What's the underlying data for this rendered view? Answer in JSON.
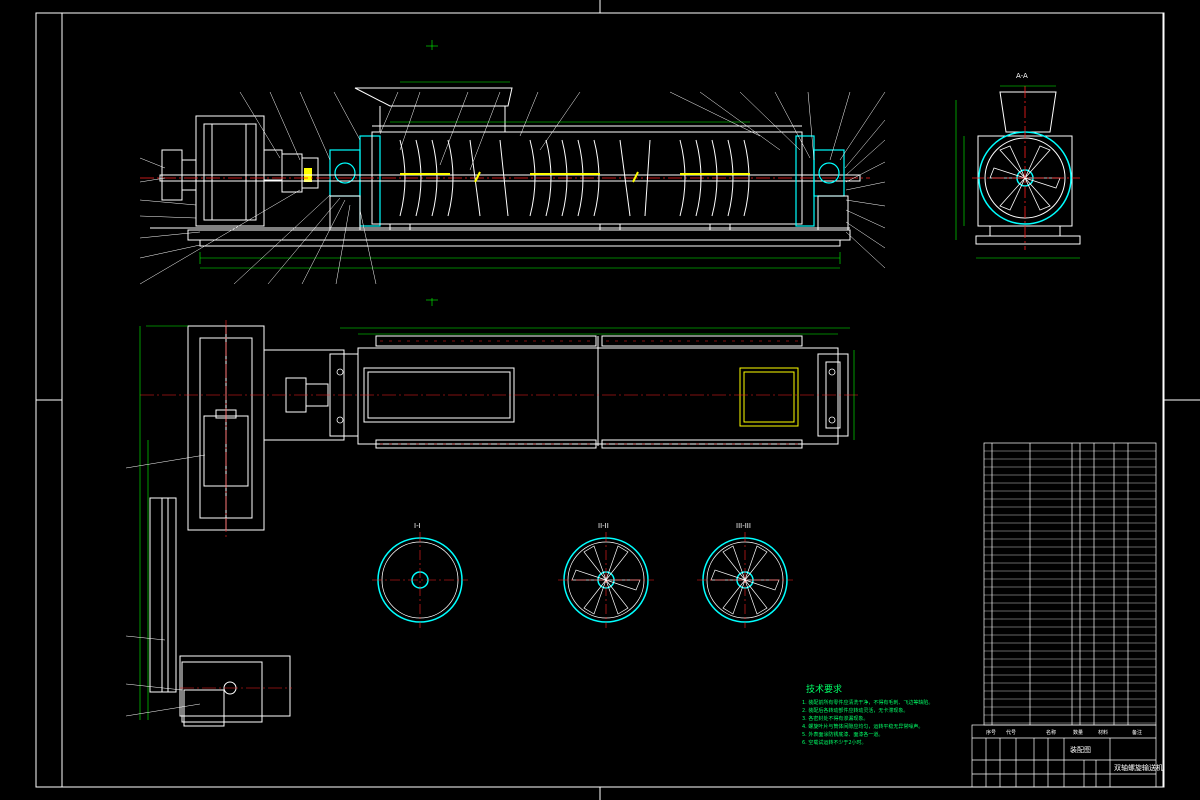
{
  "drawing": {
    "colors": {
      "background": "#000000",
      "outline": "#ffffff",
      "section": "#00ffff",
      "centerline": "#ff2020",
      "dimension": "#00ff00",
      "hatch": "#ffff00",
      "note": "#00ff66"
    },
    "section_labels": [
      "I-I",
      "II-II",
      "III-III"
    ],
    "view_label": "A-A",
    "tech_requirements": {
      "title": "技术要求",
      "lines": [
        "1. 装配前所有零件应清洗干净，不得有毛刺、飞边等缺陷。",
        "2. 装配后各转动部件应转动灵活，无卡滞现象。",
        "3. 各密封处不得有渗漏现象。",
        "4. 螺旋叶片与筒体间隙应均匀，运转平稳无异常噪声。",
        "5. 外表面涂防锈底漆、面漆各一道。",
        "6. 空载试运转不少于2小时。"
      ]
    },
    "title_block": {
      "drawing_name": "双轴螺旋输送机",
      "company": "装配图",
      "headers": [
        "序号",
        "代号",
        "名称",
        "数量",
        "材料",
        "备注"
      ]
    }
  }
}
